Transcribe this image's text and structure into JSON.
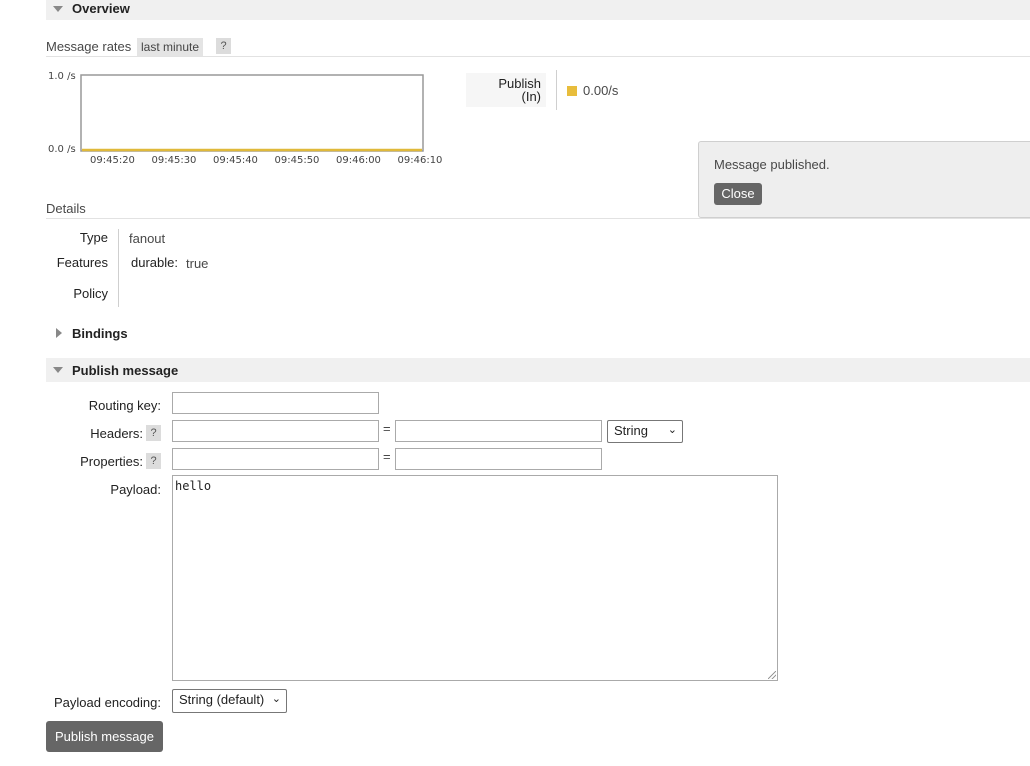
{
  "overview": {
    "title": "Overview",
    "message_rates_label": "Message rates",
    "period": "last minute",
    "help": "?",
    "chart_data": {
      "type": "line",
      "x": [
        "09:45:20",
        "09:45:30",
        "09:45:40",
        "09:45:50",
        "09:46:00",
        "09:46:10"
      ],
      "series": [
        {
          "name": "Publish (In)",
          "values": [
            0,
            0,
            0,
            0,
            0,
            0
          ],
          "color": "#e0b93a"
        }
      ],
      "yticks": [
        "1.0 /s",
        "0.0 /s"
      ],
      "ylim": [
        0,
        1
      ]
    },
    "legend": {
      "label_line1": "Publish",
      "label_line2": "(In)",
      "value": "0.00/s",
      "color": "#e8bd3c"
    }
  },
  "notification": {
    "message": "Message published.",
    "close_label": "Close"
  },
  "details": {
    "title": "Details",
    "type_label": "Type",
    "type_value": "fanout",
    "features_label": "Features",
    "durable_label": "durable:",
    "durable_value": "true",
    "policy_label": "Policy"
  },
  "bindings": {
    "title": "Bindings"
  },
  "publish": {
    "title": "Publish message",
    "routing_key_label": "Routing key:",
    "headers_label": "Headers:",
    "properties_label": "Properties:",
    "help": "?",
    "equals": "=",
    "header_type": "String",
    "payload_label": "Payload:",
    "payload_value": "hello",
    "encoding_label": "Payload encoding:",
    "encoding_value": "String (default)",
    "submit_label": "Publish message"
  }
}
